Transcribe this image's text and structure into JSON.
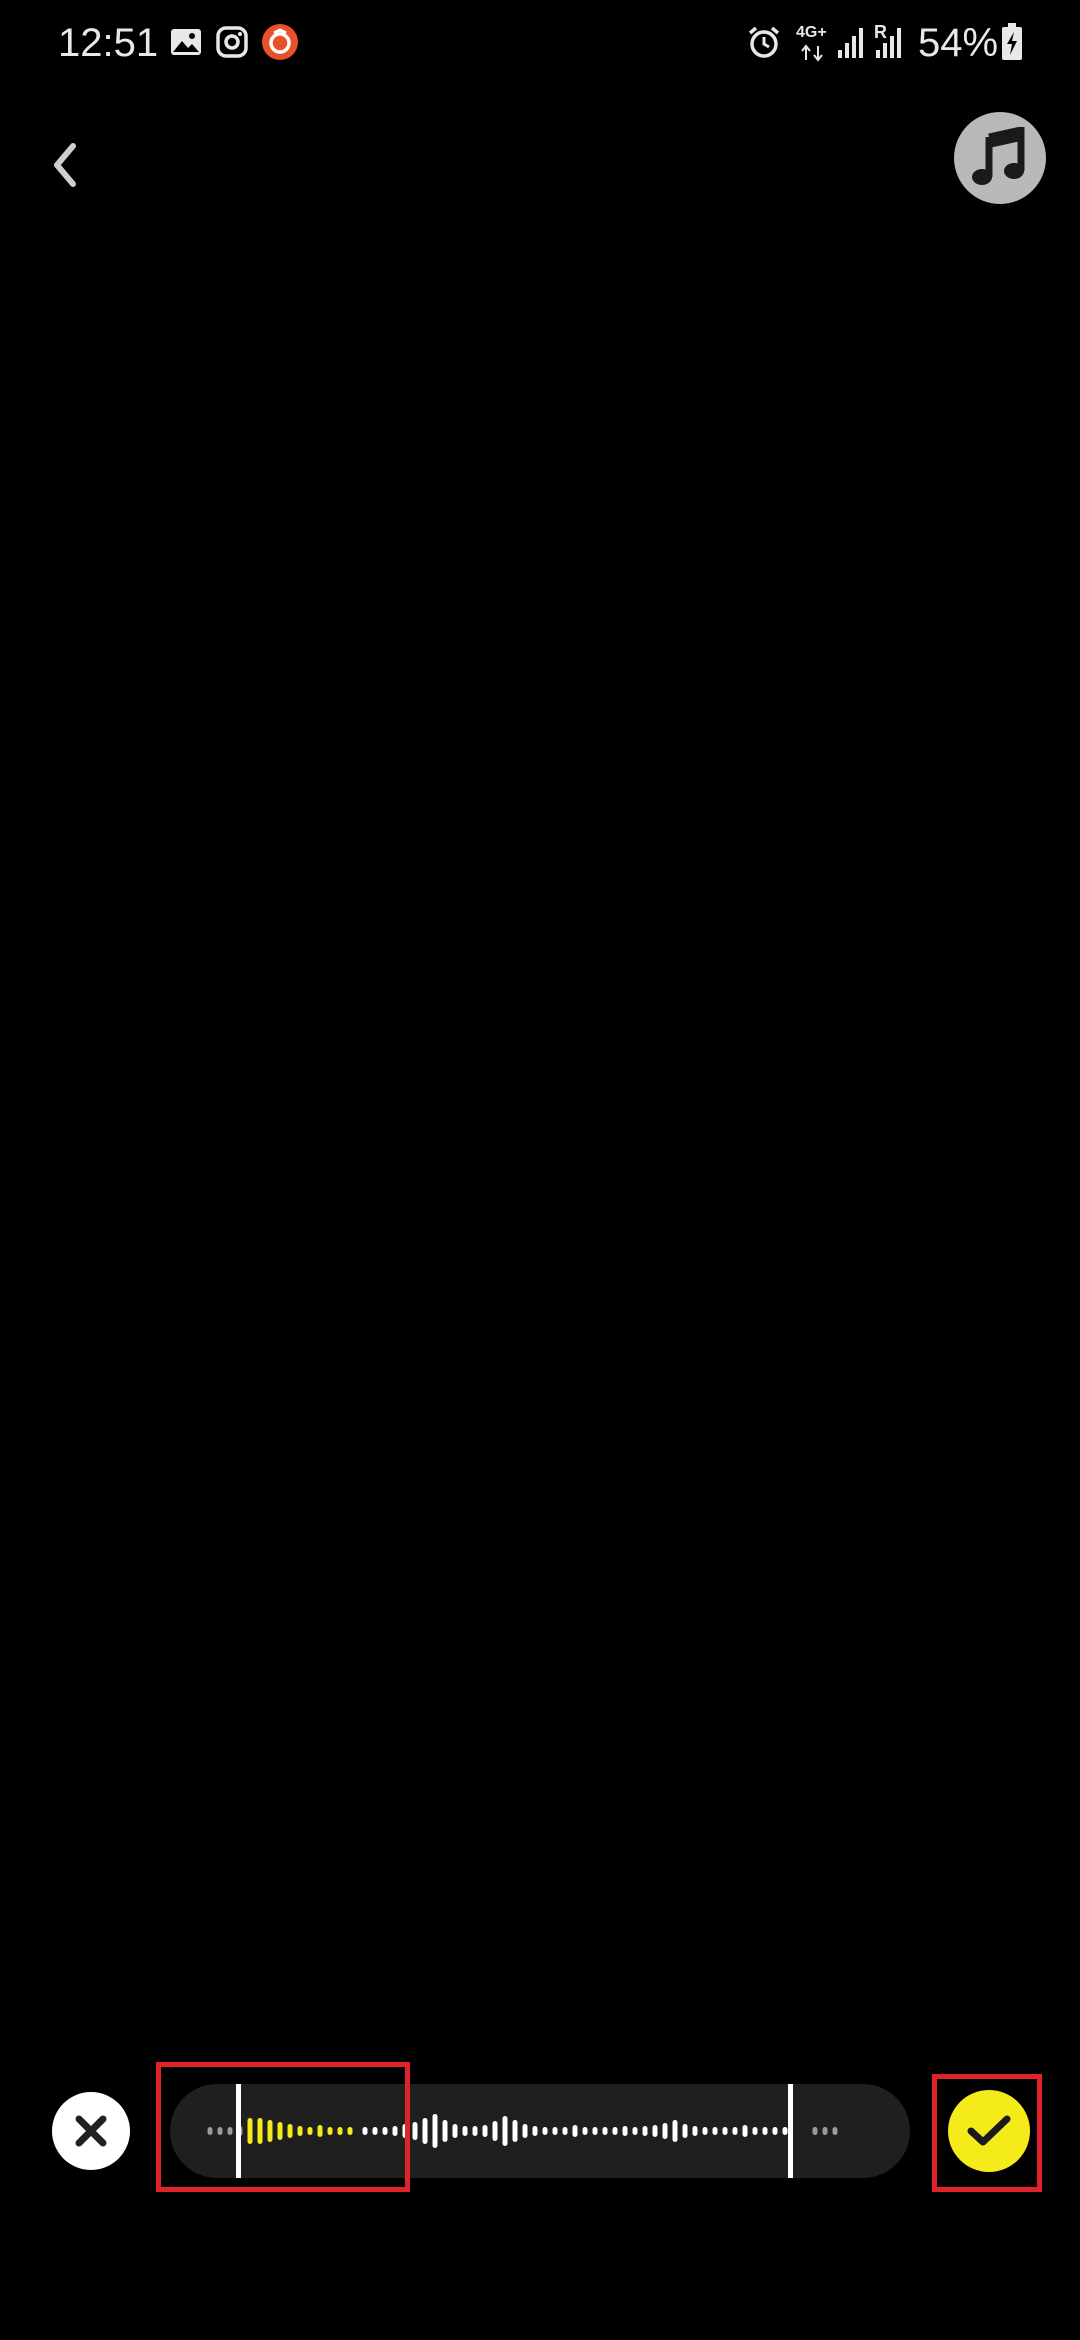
{
  "status_bar": {
    "time": "12:51",
    "network": "4G+",
    "roaming": "R",
    "battery": "54%",
    "left_icons": [
      "gallery-icon",
      "instagram-icon",
      "app-notification-icon"
    ],
    "right_icons": [
      "alarm-icon",
      "signal-icon",
      "signal-roaming-icon",
      "battery-charging-icon"
    ]
  },
  "top_controls": {
    "back": "chevron-left-icon",
    "music": "music-note-icon"
  },
  "audio_trim": {
    "close": "close-icon",
    "confirm": "checkmark-icon",
    "colors": {
      "selected_wave": "#f5ea1a",
      "wave": "#ffffff",
      "dim_wave": "#9a9a9a",
      "track": "#1f1f1f",
      "highlight": "#e0222a"
    }
  }
}
